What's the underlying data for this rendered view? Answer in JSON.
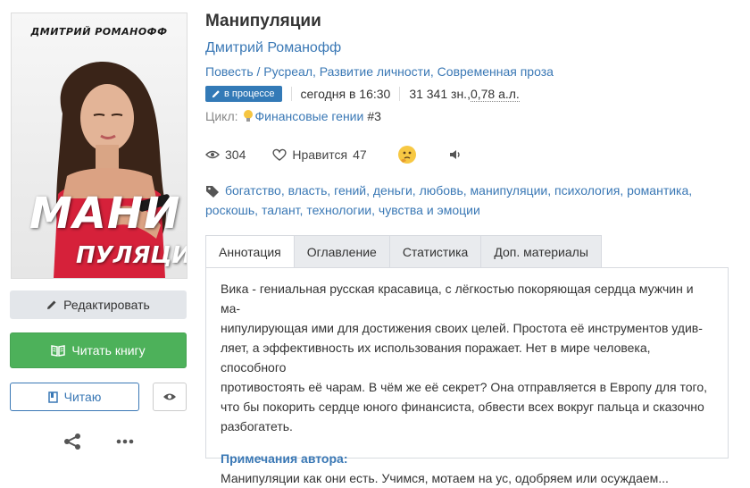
{
  "cover": {
    "author_text": "ДМИТРИЙ РОМАНОФФ",
    "title_line1": "МАНИ",
    "title_line2": "ПУЛЯЦИИ"
  },
  "sidebar": {
    "edit_label": "Редактировать",
    "read_label": "Читать книгу",
    "reading_label": "Читаю"
  },
  "book": {
    "title": "Манипуляции",
    "author": "Дмитрий Романофф",
    "genres": "Повесть / Русреал, Развитие личности, Современная проза",
    "status_badge": "в процессе",
    "updated": "сегодня в 16:30",
    "size_chars": "31 341 зн., ",
    "size_al": "0,78 а.л.",
    "cycle_label": "Цикл:",
    "cycle_name": "Финансовые гении",
    "cycle_number": "#3"
  },
  "stats": {
    "views": "304",
    "likes_label": "Нравится",
    "likes": "47"
  },
  "tags": "богатство, власть, гений, деньги, любовь, манипуляции, психология, романтика, роскошь, талант, технологии, чувства и эмоции",
  "tabs": [
    {
      "label": "Аннотация"
    },
    {
      "label": "Оглавление"
    },
    {
      "label": "Статистика"
    },
    {
      "label": "Доп. материалы"
    }
  ],
  "annotation": {
    "line1": "Вика - гениальная русская красавица, с лёгкостью покоряющая сердца мужчин и ма-",
    "line2": "нипулирующая ими для достижения своих целей. Простота её инструментов удив-",
    "line3": "ляет, а эффективность их использования поражает. Нет в мире человека, способного",
    "line4": "противостоять её чарам. В чём же её секрет? Она отправляется в Европу для того,",
    "line5": "что бы покорить сердце юного финансиста, обвести всех вокруг пальца и сказочно",
    "line6": "разбогатеть.",
    "notes_title": "Примечания автора:",
    "notes_text": "Манипуляции как они есть. Учимся, мотаем на ус, одобряем или осуждаем..."
  },
  "colors": {
    "link": "#3a78b5",
    "green": "#4db15a",
    "badge": "#337ab7"
  }
}
